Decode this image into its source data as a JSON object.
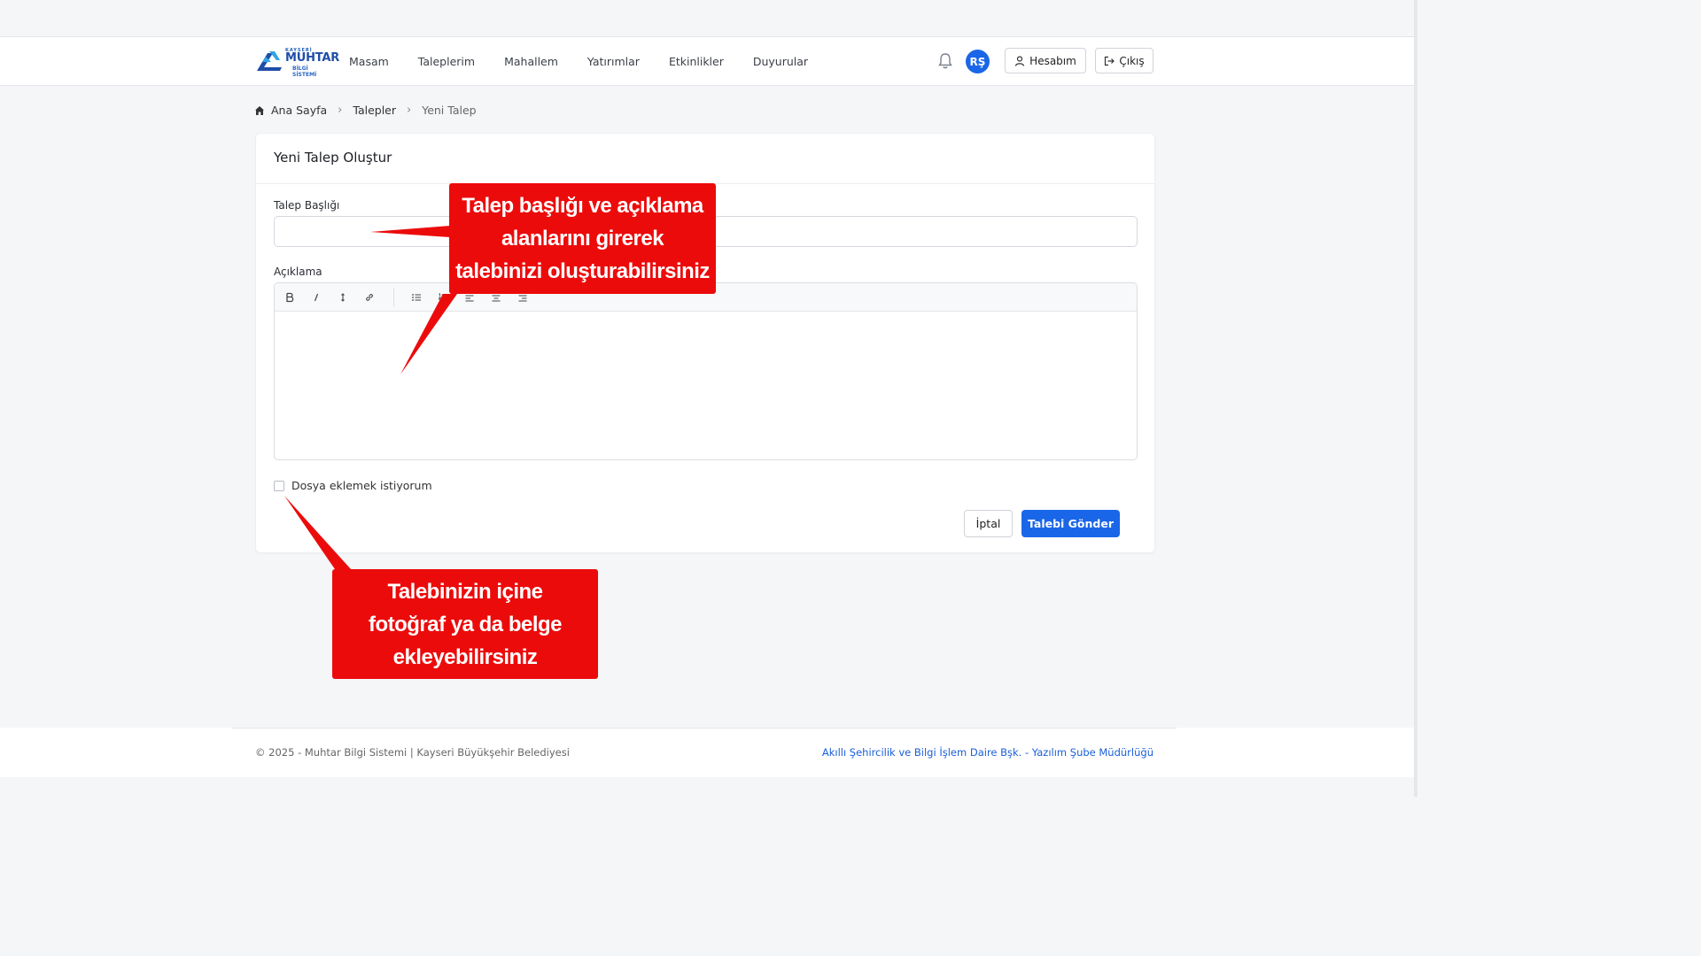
{
  "brand": {
    "logo_top": "KAYSERİ",
    "logo_main": "MUHTAR",
    "logo_sub": "BİLGİ SİSTEMİ"
  },
  "nav": {
    "items": [
      {
        "label": "Masam"
      },
      {
        "label": "Taleplerim"
      },
      {
        "label": "Mahallem"
      },
      {
        "label": "Yatırımlar"
      },
      {
        "label": "Etkinlikler"
      },
      {
        "label": "Duyurular"
      }
    ],
    "avatar_initials": "RŞ",
    "account_label": "Hesabım",
    "logout_label": "Çıkış"
  },
  "breadcrumb": {
    "home": "Ana Sayfa",
    "section": "Talepler",
    "current": "Yeni Talep"
  },
  "form": {
    "title": "Yeni Talep Oluştur",
    "title_field_label": "Talep Başlığı",
    "title_field_value": "",
    "description_label": "Açıklama",
    "editor_tools": [
      "bold-icon",
      "italic-icon",
      "font-size-icon",
      "link-icon",
      "bullet-list-icon",
      "ordered-list-icon",
      "align-left-icon",
      "align-center-icon",
      "align-right-icon"
    ],
    "attach_checkbox_label": "Dosya eklemek istiyorum",
    "attach_checked": false,
    "cancel_label": "İptal",
    "submit_label": "Talebi Gönder"
  },
  "callouts": {
    "first": [
      "Talep başlığı ve açıklama",
      "alanlarını girerek",
      "talebinizi oluşturabilirsiniz"
    ],
    "second": [
      "Talebinizin içine",
      "fotoğraf ya da belge",
      "ekleyebilirsiniz"
    ]
  },
  "footer": {
    "left": "© 2025 - Muhtar Bilgi Sistemi | Kayseri Büyükşehir Belediyesi",
    "right": "Akıllı Şehircilik ve Bilgi İşlem Daire Bşk. - Yazılım Şube Müdürlüğü"
  },
  "colors": {
    "primary": "#1a66e8",
    "callout": "#ec0b0b",
    "logo_blue": "#1f4ea8"
  }
}
